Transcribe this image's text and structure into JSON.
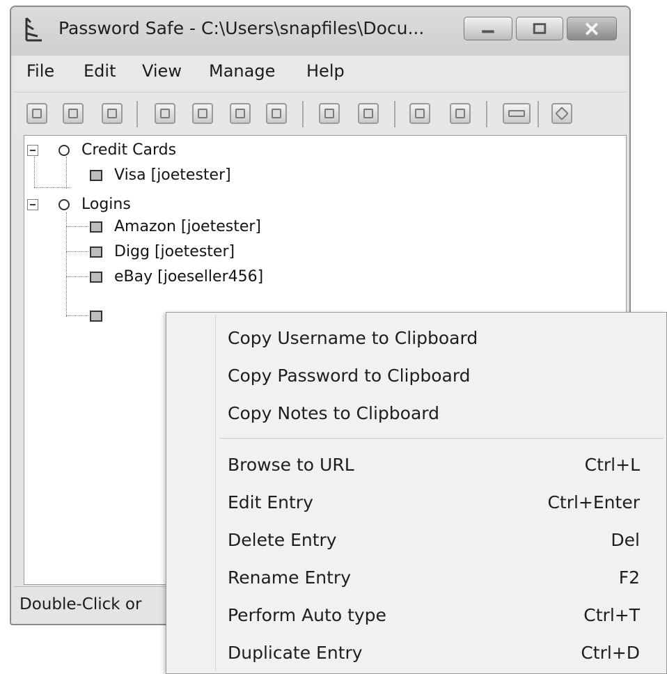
{
  "window": {
    "title": "Password Safe - C:\\Users\\snapfiles\\Docu..."
  },
  "menubar": {
    "items": [
      "File",
      "Edit",
      "View",
      "Manage",
      "Help"
    ]
  },
  "toolbar": {
    "icons": [
      "new-database-icon",
      "open-database-icon",
      "save-database-icon",
      "copy-password-icon",
      "copy-username-icon",
      "copy-notes-icon",
      "clear-clipboard-icon",
      "autotype-icon",
      "browse-url-icon",
      "add-entry-icon",
      "edit-entry-icon",
      "delete-entry-icon",
      "options-icon"
    ]
  },
  "tree": {
    "groups": [
      {
        "label": "Credit Cards",
        "entries": [
          "Visa [joetester]"
        ]
      },
      {
        "label": "Logins",
        "entries": [
          "Amazon [joetester]",
          "Digg [joetester]",
          "eBay [joeseller456]",
          ""
        ]
      }
    ]
  },
  "status": {
    "text": "Double-Click or"
  },
  "context_menu": {
    "clipboard_items": [
      "Copy Username to Clipboard",
      "Copy Password to Clipboard",
      "Copy Notes to Clipboard"
    ],
    "action_items": [
      {
        "label": "Browse to URL",
        "shortcut": "Ctrl+L"
      },
      {
        "label": "Edit Entry",
        "shortcut": "Ctrl+Enter"
      },
      {
        "label": "Delete Entry",
        "shortcut": "Del"
      },
      {
        "label": "Rename Entry",
        "shortcut": "F2"
      },
      {
        "label": "Perform Auto type",
        "shortcut": "Ctrl+T"
      },
      {
        "label": "Duplicate Entry",
        "shortcut": "Ctrl+D"
      }
    ]
  }
}
